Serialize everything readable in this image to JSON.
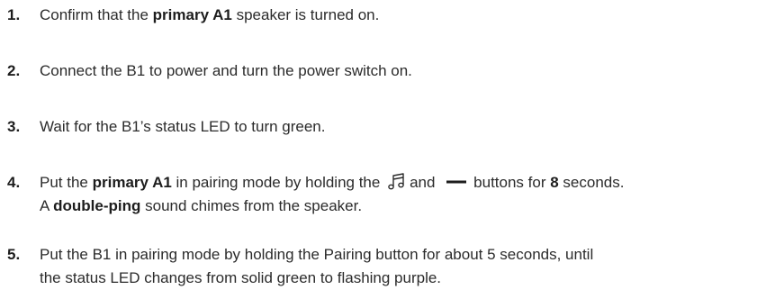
{
  "steps": [
    {
      "number": "1.",
      "lines": [
        [
          {
            "t": "Confirm that the "
          },
          {
            "t": "primary A1",
            "b": true
          },
          {
            "t": " speaker is turned on."
          }
        ]
      ]
    },
    {
      "number": "2.",
      "lines": [
        [
          {
            "t": "Connect the B1 to power and turn the power switch on."
          }
        ]
      ]
    },
    {
      "number": "3.",
      "lines": [
        [
          {
            "t": "Wait for the B1’s status LED to turn green."
          }
        ]
      ]
    },
    {
      "number": "4.",
      "lines": [
        [
          {
            "t": "Put the "
          },
          {
            "t": "primary A1",
            "b": true
          },
          {
            "t": " in pairing mode by holding the "
          },
          {
            "icon": "music-note-icon"
          },
          {
            "t": "and "
          },
          {
            "icon": "minus-icon"
          },
          {
            "t": "buttons for "
          },
          {
            "t": "8",
            "b": true
          },
          {
            "t": " seconds."
          }
        ],
        [
          {
            "t": "A "
          },
          {
            "t": "double-ping",
            "b": true
          },
          {
            "t": " sound chimes from the speaker."
          }
        ]
      ]
    },
    {
      "number": "5.",
      "lines": [
        [
          {
            "t": "Put the B1 in pairing mode by holding the Pairing button for about 5 seconds, until"
          }
        ],
        [
          {
            "t": "the status LED changes from solid green to flashing purple."
          }
        ]
      ]
    }
  ]
}
